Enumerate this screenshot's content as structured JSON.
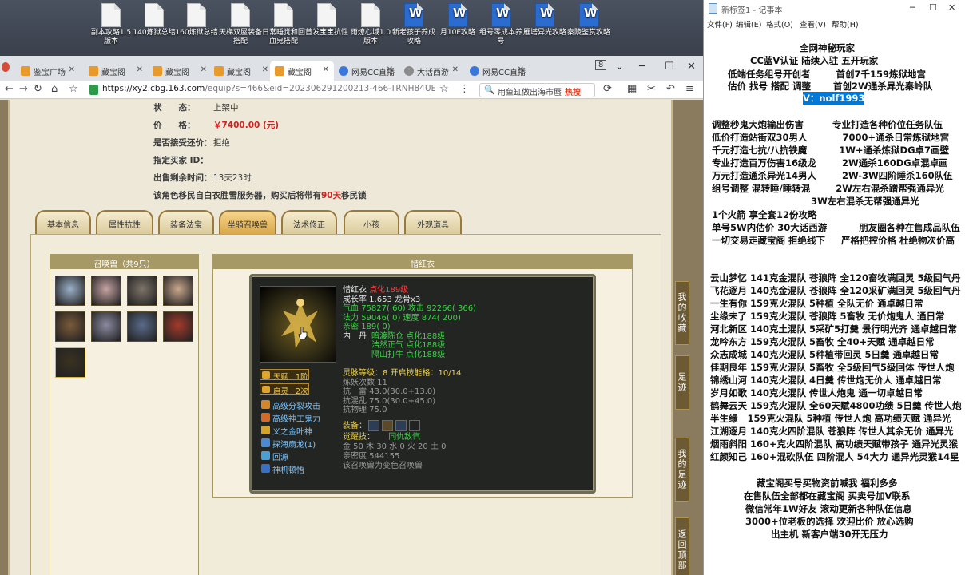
{
  "desktop": {
    "icons": [
      {
        "label": "副本攻略1.5版本",
        "type": "txt"
      },
      {
        "label": "140炼狱总结",
        "type": "txt"
      },
      {
        "label": "160炼狱总结",
        "type": "txt"
      },
      {
        "label": "天梯双屋装备搭配",
        "type": "txt"
      },
      {
        "label": "日常睡觉和回血鬼搭配",
        "type": "txt"
      },
      {
        "label": "首发宝宝抗性",
        "type": "txt"
      },
      {
        "label": "雨燎心域1.0版本",
        "type": "txt"
      },
      {
        "label": "新老孩子养成攻略",
        "type": "word"
      },
      {
        "label": "月10E攻略",
        "type": "word"
      },
      {
        "label": "组号零成本养号",
        "type": "word"
      },
      {
        "label": "雁塔异光攻略",
        "type": "word"
      },
      {
        "label": "秦陵鉴赏攻略",
        "type": "word"
      }
    ]
  },
  "browser": {
    "tabs": [
      {
        "label": "鉴宝广场",
        "icon": "orange"
      },
      {
        "label": "藏宝阁",
        "icon": "orange"
      },
      {
        "label": "藏宝阁",
        "icon": "orange"
      },
      {
        "label": "藏宝阁",
        "icon": "orange"
      },
      {
        "label": "藏宝阁",
        "icon": "orange",
        "active": true
      },
      {
        "label": "网易CC直播",
        "icon": "blue"
      },
      {
        "label": "大话西游",
        "icon": "gray"
      },
      {
        "label": "网易CC直播",
        "icon": "blue"
      }
    ],
    "tab_count": "8",
    "url_host": "https://xy2.cbg.163.com",
    "url_path": "/equip?s=466&eid=202306291200213-466-TRNH84UEG7IAi",
    "search_placeholder": "用鱼缸做出海市蜃",
    "search_hot": "热搜"
  },
  "listing": {
    "status_label": "状　　态：",
    "status_value": "上架中",
    "price_label": "价　　格：",
    "price_value": "￥7400.00 (元)",
    "bargain_label": "是否接受还价：",
    "bargain_value": "拒绝",
    "buyer_label": "指定买家 ID：",
    "buyer_value": "",
    "remaining_label": "出售剩余时间：",
    "remaining_value": "13天23时",
    "migrate_pre": "该角色移民自白衣胜雪服务器，购买后将带有",
    "migrate_days": "90天",
    "migrate_post": "移民锁"
  },
  "tabs": [
    {
      "label": "基本信息"
    },
    {
      "label": "属性抗性"
    },
    {
      "label": "装备法宝"
    },
    {
      "label": "坐骑召唤兽",
      "active": true
    },
    {
      "label": "法术修正"
    },
    {
      "label": "小孩"
    },
    {
      "label": "外观道具"
    }
  ],
  "pet_list": {
    "title": "召唤兽（共9只）",
    "pets": [
      {
        "color": "#9bb0c8"
      },
      {
        "color": "#c6a3a3"
      },
      {
        "color": "#7d7468"
      },
      {
        "color": "#c9a88d"
      },
      {
        "color": "#7b5a3a"
      },
      {
        "color": "#8a8aa0"
      },
      {
        "color": "#5a6b8a"
      },
      {
        "color": "#a53a2a"
      },
      {
        "color": "#3a3220"
      }
    ]
  },
  "pet_detail": {
    "title": "惜红衣",
    "name": "惜红衣",
    "level_tag": "点化189级",
    "growth": "成长率 1.653 龙骨x3",
    "hp_label": "气血 ",
    "hp": "75827( 60)",
    "atk_label": " 攻击 ",
    "atk": "92266( 366)",
    "mp_label": "法力 ",
    "mp": "59046( 0)",
    "spd_label": " 速度 ",
    "spd": "874( 200)",
    "close_label": "亲密 ",
    "close": "189( 0)",
    "neidan_label": "内　丹",
    "neidan": [
      "暗渡陈仓 点化188级",
      "浩然正气 点化188级",
      "隔山打牛 点化188级"
    ],
    "talent_label": "天赋 · 1阶",
    "qiling_label": "启灵 · 2次",
    "spirit_level": "灵脉等级：8 开启技能格：10/14",
    "refine_count": "炼妖次数 11",
    "resist": [
      "抗　雷 43.0(30.0+13.0)",
      "抗混乱 75.0(30.0+45.0)",
      "抗物理 75.0"
    ],
    "skills": [
      {
        "name": "高级分裂攻击",
        "color": "#d4862a"
      },
      {
        "name": "高级神工鬼力",
        "color": "#d46a2a"
      },
      {
        "name": "义之金叶神",
        "color": "#d4a42a"
      },
      {
        "name": "探海扇龙(1)",
        "color": "#4a8ad4"
      },
      {
        "name": "回源",
        "color": "#4aa0d4"
      },
      {
        "name": "神机顿悟",
        "color": "#3a70c4"
      }
    ],
    "equip_label": "装备：",
    "awaken_label": "觉醒技：",
    "awaken_value": "同仇敌忾",
    "elements": "金 50 木 30 水 0 火 20 土 0",
    "intimacy": "亲密度 544155",
    "transform_note": "该召唤兽为变色召唤兽"
  },
  "side_buttons": [
    {
      "label": "我的收藏"
    },
    {
      "label": "足迹"
    },
    {
      "label": "我的足迹"
    },
    {
      "label": "返回顶部"
    }
  ],
  "notepad": {
    "title": "新标签1 - 记事本",
    "menu": [
      "文件(F)",
      "编辑(E)",
      "格式(O)",
      "查看(V)",
      "帮助(H)"
    ],
    "lines": [
      "全网神秘玩家",
      "CC蓝V认证 陆续入驻 五开玩家",
      "低端任务组号开创者        首创7千159炼狱地宫",
      "估价 找号 搭配 调整       首创2W通杀异光秦岭队",
      "V：nolf1993",
      "调整秒鬼大炮输出伤害         专业打造各种价位任务队伍",
      "低价打造站街双30男人           7000+通杀日常炼狱地宫",
      "千元打造七抗/八抗铁魔          1W+通杀炼狱DG卓7画壁",
      "专业打造百万伤害16级龙        2W通杀160DG卓混卓画",
      "万元打造通杀异光14男人        2W-3W四阶睡杀160队伍",
      "组号调整 混转睡/睡转混        2W左右混杀蹭帮强通异光",
      "                               3W左右混杀无帮强通异光",
      "1个火箭 享全套12份攻略",
      "单号5W内估价 30大话西游          朋友圈各种在售成品队伍",
      "一切交易走藏宝阁 拒绝线下     严格把控价格 杜绝物次价高",
      "云山梦忆 141克金混队 苍狼阵 全120畜牧满回灵 5级回气丹",
      "飞花逐月 140克金混队 苍狼阵 全120采矿满回灵 5级回气丹",
      "一生有你 159克火混队 5种植 全队无价 通卓越日常",
      "尘缘未了 159克火混队 苍狼阵 5畜牧 无价炮鬼人 通日常",
      "河北新区 140克土混队 5采矿5打羹 景行明光齐 通卓越日常",
      "龙吟东方 159克火混队 5畜牧 全40+天赋 通卓越日常",
      "众志成城 140克火混队 5种植带回灵 5日羹 通卓越日常",
      "佳期良年 159克火混队 5畜牧 全5级回气5级回体 传世人炮",
      "锦绣山河 140克火混队 4日羹 传世炮无价人 通卓越日常",
      "岁月如歌 140克火混队 传世人炮鬼 通一切卓越日常",
      "鹤舞云天 159克火混队 全60天赋4800功绩 5日羹 传世人炮",
      "半生缘   159克火混队 5种植 传世人炮 高功绩天赋 通异光",
      "江湖逐月 140克火四阶混队 苍狼阵 传世人其余无价 通异光",
      "烟雨斜阳 160+克火四阶混队 高功绩天赋带孩子 通异光灵猴",
      "红颜知己 160+混砍队伍 四阶混人 54大力 通异光灵猴14星",
      "藏宝阁买号买物资前喊我 福利多多",
      "在售队伍全部都在藏宝阁 买卖号加V联系",
      "微信常年1W好友 滚动更新各种队伍信息",
      "3000+位老板的选择 欢迎比价 放心选购",
      "出主机 新客户端30开无压力"
    ]
  }
}
